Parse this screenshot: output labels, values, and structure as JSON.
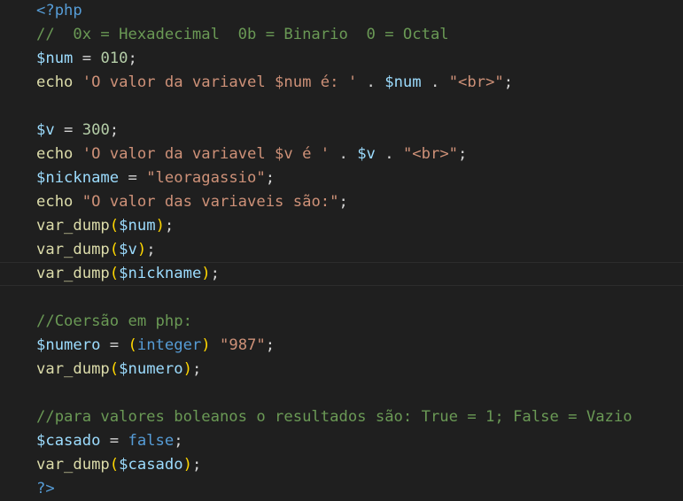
{
  "editor": {
    "active_line": 11,
    "lines": [
      [
        {
          "t": "<?php",
          "c": "keyword"
        }
      ],
      [
        {
          "t": "//  0x = Hexadecimal  0b = Binario  0 = Octal",
          "c": "comment"
        }
      ],
      [
        {
          "t": "$num",
          "c": "variable"
        },
        {
          "t": " = ",
          "c": "op"
        },
        {
          "t": "010",
          "c": "number"
        },
        {
          "t": ";",
          "c": "op"
        }
      ],
      [
        {
          "t": "echo ",
          "c": "func"
        },
        {
          "t": "'O valor da variavel $num é: '",
          "c": "string"
        },
        {
          "t": " . ",
          "c": "op"
        },
        {
          "t": "$num",
          "c": "variable"
        },
        {
          "t": " . ",
          "c": "op"
        },
        {
          "t": "\"<br>\"",
          "c": "string"
        },
        {
          "t": ";",
          "c": "op"
        }
      ],
      [],
      [
        {
          "t": "$v",
          "c": "variable"
        },
        {
          "t": " = ",
          "c": "op"
        },
        {
          "t": "300",
          "c": "number"
        },
        {
          "t": ";",
          "c": "op"
        }
      ],
      [
        {
          "t": "echo ",
          "c": "func"
        },
        {
          "t": "'O valor da variavel $v é '",
          "c": "string"
        },
        {
          "t": " . ",
          "c": "op"
        },
        {
          "t": "$v",
          "c": "variable"
        },
        {
          "t": " . ",
          "c": "op"
        },
        {
          "t": "\"<br>\"",
          "c": "string"
        },
        {
          "t": ";",
          "c": "op"
        }
      ],
      [
        {
          "t": "$nickname",
          "c": "variable"
        },
        {
          "t": " = ",
          "c": "op"
        },
        {
          "t": "\"leoragassio\"",
          "c": "string"
        },
        {
          "t": ";",
          "c": "op"
        }
      ],
      [
        {
          "t": "echo ",
          "c": "func"
        },
        {
          "t": "\"O valor das variaveis são:\"",
          "c": "string"
        },
        {
          "t": ";",
          "c": "op"
        }
      ],
      [
        {
          "t": "var_dump",
          "c": "func"
        },
        {
          "t": "(",
          "c": "paren"
        },
        {
          "t": "$num",
          "c": "variable"
        },
        {
          "t": ")",
          "c": "paren"
        },
        {
          "t": ";",
          "c": "op"
        }
      ],
      [
        {
          "t": "var_dump",
          "c": "func"
        },
        {
          "t": "(",
          "c": "paren"
        },
        {
          "t": "$v",
          "c": "variable"
        },
        {
          "t": ")",
          "c": "paren"
        },
        {
          "t": ";",
          "c": "op"
        }
      ],
      [
        {
          "t": "var_dump",
          "c": "func"
        },
        {
          "t": "(",
          "c": "paren"
        },
        {
          "t": "$nickname",
          "c": "variable"
        },
        {
          "t": ")",
          "c": "paren"
        },
        {
          "t": ";",
          "c": "op"
        }
      ],
      [],
      [
        {
          "t": "//Coersão em php:",
          "c": "comment"
        }
      ],
      [
        {
          "t": "$numero",
          "c": "variable"
        },
        {
          "t": " = ",
          "c": "op"
        },
        {
          "t": "(",
          "c": "paren"
        },
        {
          "t": "integer",
          "c": "type"
        },
        {
          "t": ")",
          "c": "paren"
        },
        {
          "t": " ",
          "c": "op"
        },
        {
          "t": "\"987\"",
          "c": "string"
        },
        {
          "t": ";",
          "c": "op"
        }
      ],
      [
        {
          "t": "var_dump",
          "c": "func"
        },
        {
          "t": "(",
          "c": "paren"
        },
        {
          "t": "$numero",
          "c": "variable"
        },
        {
          "t": ")",
          "c": "paren"
        },
        {
          "t": ";",
          "c": "op"
        }
      ],
      [],
      [
        {
          "t": "//para valores boleanos o resultados são: True = 1; False = Vazio",
          "c": "comment"
        }
      ],
      [
        {
          "t": "$casado",
          "c": "variable"
        },
        {
          "t": " = ",
          "c": "op"
        },
        {
          "t": "false",
          "c": "bool"
        },
        {
          "t": ";",
          "c": "op"
        }
      ],
      [
        {
          "t": "var_dump",
          "c": "func"
        },
        {
          "t": "(",
          "c": "paren"
        },
        {
          "t": "$casado",
          "c": "variable"
        },
        {
          "t": ")",
          "c": "paren"
        },
        {
          "t": ";",
          "c": "op"
        }
      ],
      [
        {
          "t": "?>",
          "c": "keyword"
        }
      ]
    ]
  }
}
